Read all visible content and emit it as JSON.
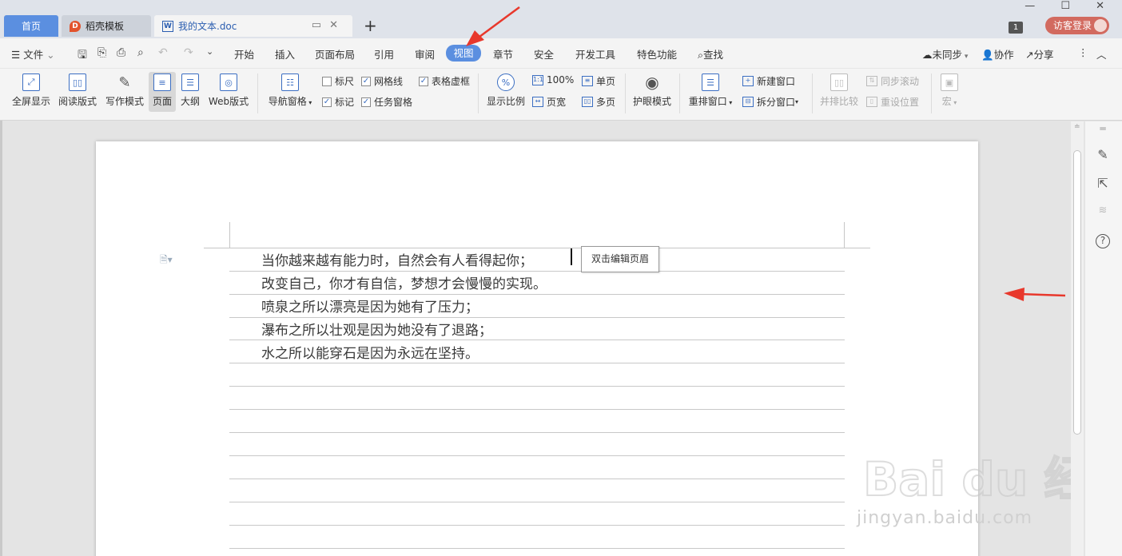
{
  "tabs": {
    "home": "首页",
    "template": "稻壳模板",
    "document": "我的文本.doc",
    "template_icon": "D",
    "doc_icon": "W",
    "new_tab": "+"
  },
  "window": {
    "badge": "1",
    "login": "访客登录",
    "controls": "— ☐ ✕"
  },
  "menu": {
    "file": "文件",
    "items": [
      "开始",
      "插入",
      "页面布局",
      "引用",
      "审阅",
      "视图",
      "章节",
      "安全",
      "开发工具",
      "特色功能"
    ],
    "search": "查找",
    "sync": "未同步",
    "collab": "协作",
    "share": "分享"
  },
  "ribbon": {
    "fullscreen": "全屏显示",
    "read_mode": "阅读版式",
    "write_mode": "写作模式",
    "page": "页面",
    "outline": "大纲",
    "web": "Web版式",
    "nav_pane": "导航窗格",
    "ruler": "标尺",
    "gridlines": "网格线",
    "table_borders": "表格虚框",
    "markup": "标记",
    "task_pane": "任务窗格",
    "zoom": "显示比例",
    "zoom_100": "100%",
    "page_width": "页宽",
    "single_page": "单页",
    "multi_page": "多页",
    "eye_protect": "护眼模式",
    "rearrange": "重排窗口",
    "new_window": "新建窗口",
    "split_window": "拆分窗口",
    "compare": "并排比较",
    "sync_scroll": "同步滚动",
    "reset_pos": "重设位置",
    "macro": "宏"
  },
  "checkboxes": {
    "ruler": false,
    "gridlines": true,
    "table_borders": true,
    "markup": true,
    "task_pane": true
  },
  "document": {
    "lines": [
      "当你越来越有能力时，自然会有人看得起你；",
      "改变自己，你才有自信，梦想才会慢慢的实现。",
      "喷泉之所以漂亮是因为她有了压力；",
      "瀑布之所以壮观是因为她没有了退路；",
      "水之所以能穿石是因为永远在坚持。"
    ],
    "header_tooltip": "双击编辑页眉"
  },
  "watermark": {
    "logo": "Bai du 经验",
    "url": "jingyan.baidu.com"
  },
  "colors": {
    "accent": "#5b8fe0",
    "annotation_arrow": "#e8382c",
    "login": "#d26a5f"
  }
}
